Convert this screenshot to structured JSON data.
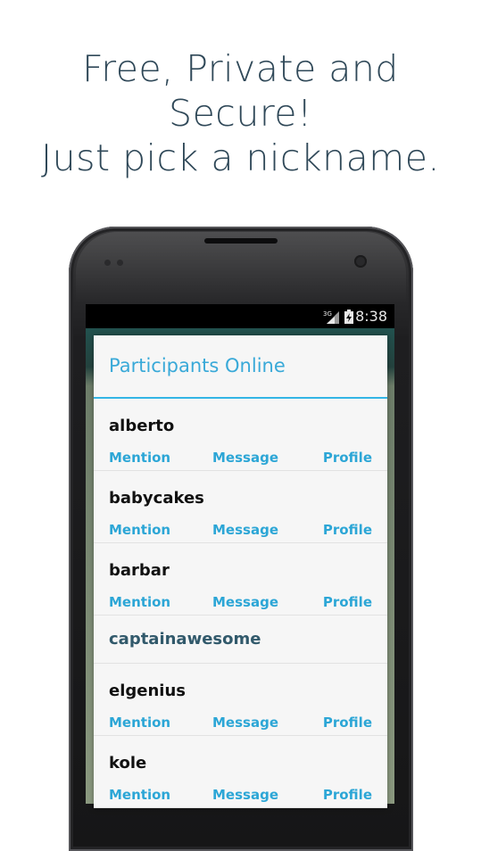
{
  "headline": {
    "line1": "Free, Private and",
    "line2": "Secure!",
    "line3": "Just pick a nickname."
  },
  "status_bar": {
    "network": "3G",
    "time": "8:38"
  },
  "dialog": {
    "title": "Participants Online",
    "actions": {
      "mention": "Mention",
      "message": "Message",
      "profile": "Profile"
    },
    "participants": [
      {
        "nick": "alberto"
      },
      {
        "nick": "babycakes"
      },
      {
        "nick": "barbar"
      },
      {
        "nick": "captainawesome"
      },
      {
        "nick": "elgenius"
      },
      {
        "nick": "kole"
      }
    ]
  },
  "colors": {
    "headline": "#2f4858",
    "accent": "#33b5e5",
    "action_text": "#2ca6d6",
    "self_nick": "#31596b"
  }
}
